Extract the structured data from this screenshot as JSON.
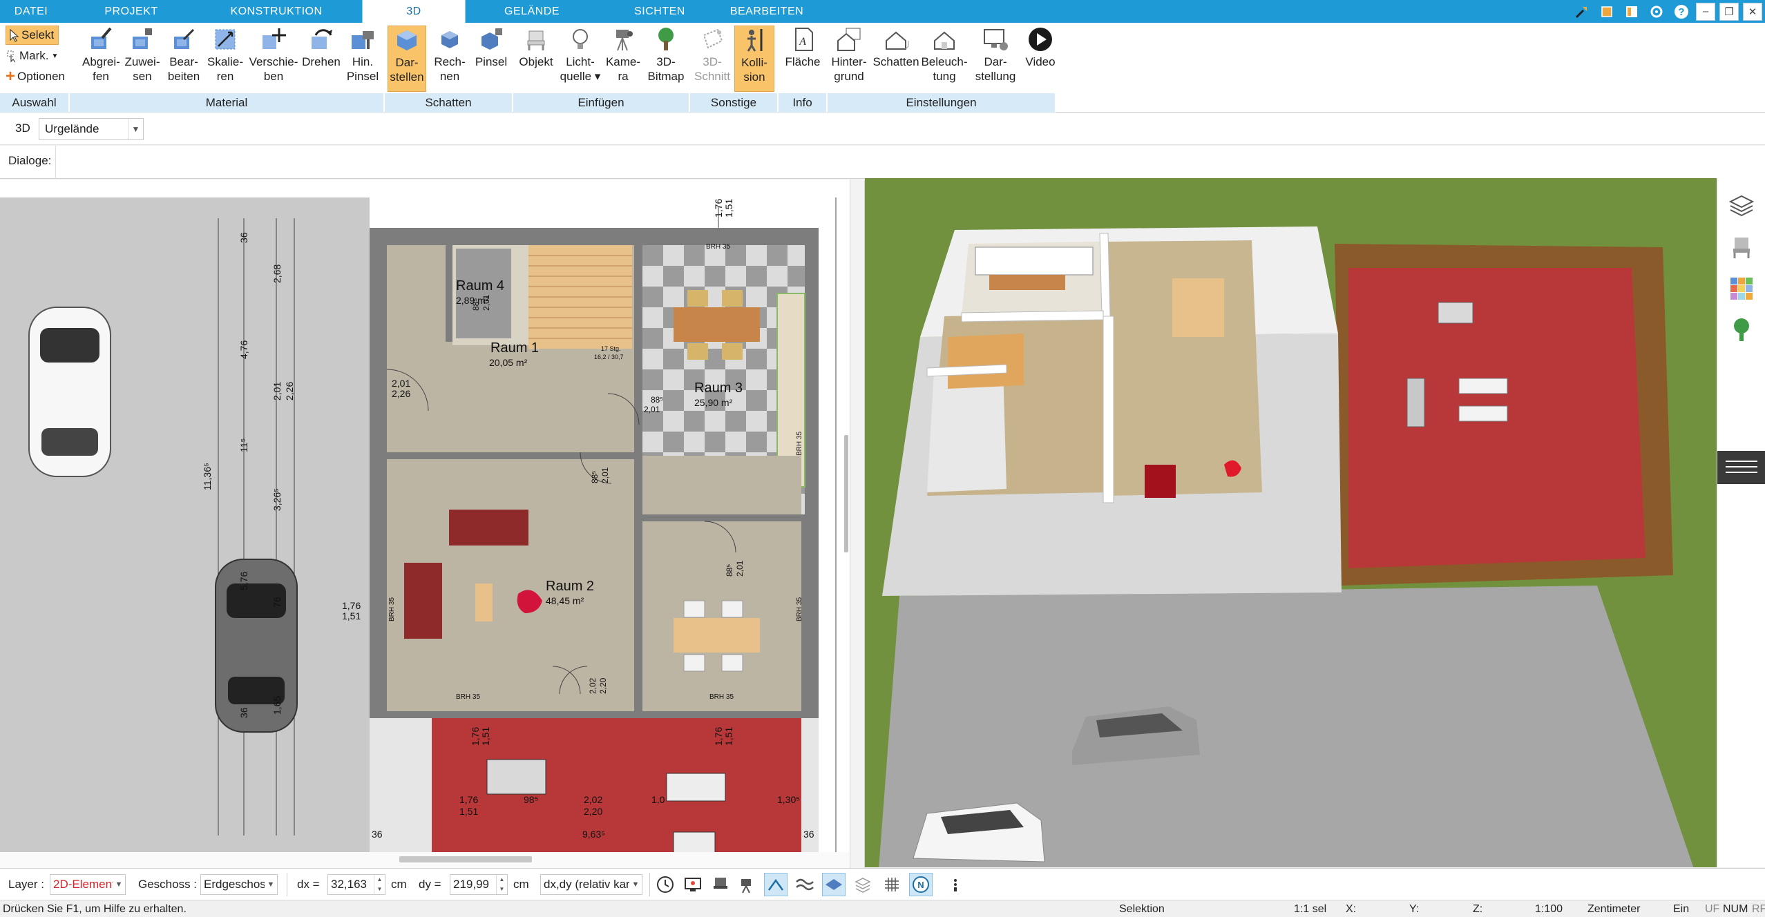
{
  "menu": {
    "tabs": [
      {
        "label": "DATEI",
        "active": false
      },
      {
        "label": "PROJEKT",
        "active": false
      },
      {
        "label": "KONSTRUKTION",
        "active": false
      },
      {
        "label": "3D",
        "active": true
      },
      {
        "label": "GELÄNDE",
        "active": false
      },
      {
        "label": "SICHTEN",
        "active": false
      },
      {
        "label": "BEARBEITEN",
        "active": false
      }
    ]
  },
  "ribbon": {
    "auswahl": {
      "items": [
        "Selekt",
        "Mark.",
        "Optionen"
      ],
      "group_label": "Auswahl"
    },
    "material": {
      "buttons": [
        {
          "line1": "Abgrei-",
          "line2": "fen"
        },
        {
          "line1": "Zuwei-",
          "line2": "sen"
        },
        {
          "line1": "Bear-",
          "line2": "beiten"
        },
        {
          "line1": "Skalie-",
          "line2": "ren"
        },
        {
          "line1": "Verschie-",
          "line2": "ben"
        },
        {
          "line1": "Drehen",
          "line2": ""
        },
        {
          "line1": "Hin.",
          "line2": "Pinsel"
        }
      ],
      "group_label": "Material"
    },
    "schatten": {
      "buttons": [
        {
          "line1": "Dar-",
          "line2": "stellen",
          "selected": true
        },
        {
          "line1": "Rech-",
          "line2": "nen"
        },
        {
          "line1": "Pinsel",
          "line2": ""
        }
      ],
      "group_label": "Schatten"
    },
    "einfuegen": {
      "buttons": [
        {
          "line1": "Objekt",
          "line2": ""
        },
        {
          "line1": "Licht-",
          "line2": "quelle ▾"
        },
        {
          "line1": "Kame-",
          "line2": "ra"
        },
        {
          "line1": "3D-",
          "line2": "Bitmap"
        }
      ],
      "group_label": "Einfügen"
    },
    "sonstige": {
      "buttons": [
        {
          "line1": "3D-",
          "line2": "Schnitt",
          "disabled": true
        },
        {
          "line1": "Kolli-",
          "line2": "sion",
          "selected": true
        }
      ],
      "group_label": "Sonstige"
    },
    "info": {
      "buttons": [
        {
          "line1": "Fläche",
          "line2": ""
        }
      ],
      "group_label": "Info"
    },
    "einstellungen": {
      "buttons": [
        {
          "line1": "Hinter-",
          "line2": "grund"
        },
        {
          "line1": "Schatten",
          "line2": ""
        },
        {
          "line1": "Beleuch-",
          "line2": "tung"
        },
        {
          "line1": "Dar-",
          "line2": "stellung"
        },
        {
          "line1": "Video",
          "line2": ""
        }
      ],
      "group_label": "Einstellungen"
    }
  },
  "toolbar3d": {
    "label": "3D",
    "combo_value": "Urgelände"
  },
  "dialoge": {
    "label": "Dialoge:"
  },
  "plan": {
    "rooms": [
      {
        "name": "Raum 4",
        "area": "2,89 m²"
      },
      {
        "name": "Raum 1",
        "area": "20,05 m²"
      },
      {
        "name": "Raum 3",
        "area": "25,90 m²"
      },
      {
        "name": "Raum 2",
        "area": "48,45 m²"
      }
    ],
    "dims": {
      "d1": "36",
      "d2": "2,68",
      "d3": "4,76",
      "d4": "2,01",
      "d5": "2,26",
      "d6": "11,36⁵",
      "d7": "11⁵",
      "d8": "3,26⁵",
      "d9": "5,76",
      "d10": "76",
      "d11": "1,65",
      "d12": "36",
      "d13": "1,76",
      "d14": "1,51",
      "d15": "1,76",
      "d16": "1,51",
      "d17": "2,01",
      "d18": "2,26",
      "d19": "88⁵",
      "d20": "2,01",
      "d21": "88⁵",
      "d22": "2,01",
      "d23": "88⁵",
      "d24": "2,01",
      "d25": "2,02",
      "d26": "2,20",
      "d27": "1,76",
      "d28": "1,51",
      "d29": "1,76",
      "d30": "1,51",
      "d31": "2,02",
      "d32": "2,20",
      "d33": "98⁵",
      "d34": "1,0",
      "d35": "1,30⁵",
      "d36": "9,63⁵",
      "d37": "36",
      "d38": "36",
      "d39": "88⁵",
      "d40": "2,01",
      "brh1": "BRH 35",
      "brh2": "BRH 35",
      "brh3": "BRH 35",
      "brh4": "BRH 35",
      "brh5": "BRH 35",
      "brh6": "BRH 35",
      "stair": "17 Stg.",
      "stair2": "16,2 / 30,7"
    }
  },
  "bottom": {
    "layer_label": "Layer :",
    "layer_value": "2D-Elemente",
    "geschoss_label": "Geschoss :",
    "geschoss_value": "Erdgeschoss",
    "dx_label": "dx =",
    "dx_value": "32,163",
    "dx_unit": "cm",
    "dy_label": "dy =",
    "dy_value": "219,99",
    "dy_unit": "cm",
    "mode_value": "dx,dy (relativ kartesisch)"
  },
  "status": {
    "help": "Drücken Sie F1, um Hilfe zu erhalten.",
    "mode": "Selektion",
    "sel": "1:1 sel",
    "x": "X:",
    "y": "Y:",
    "z": "Z:",
    "scale": "1:100",
    "unit": "Zentimeter",
    "ein": "Ein",
    "uf": "UF",
    "num": "NUM",
    "rf": "RF"
  },
  "colors": {
    "accent": "#1e9ad6",
    "group_label_bg": "#d7eaf7",
    "selected_btn": "#f9c36a",
    "grass": "#6d8d3a",
    "terrace": "#b8383a"
  }
}
